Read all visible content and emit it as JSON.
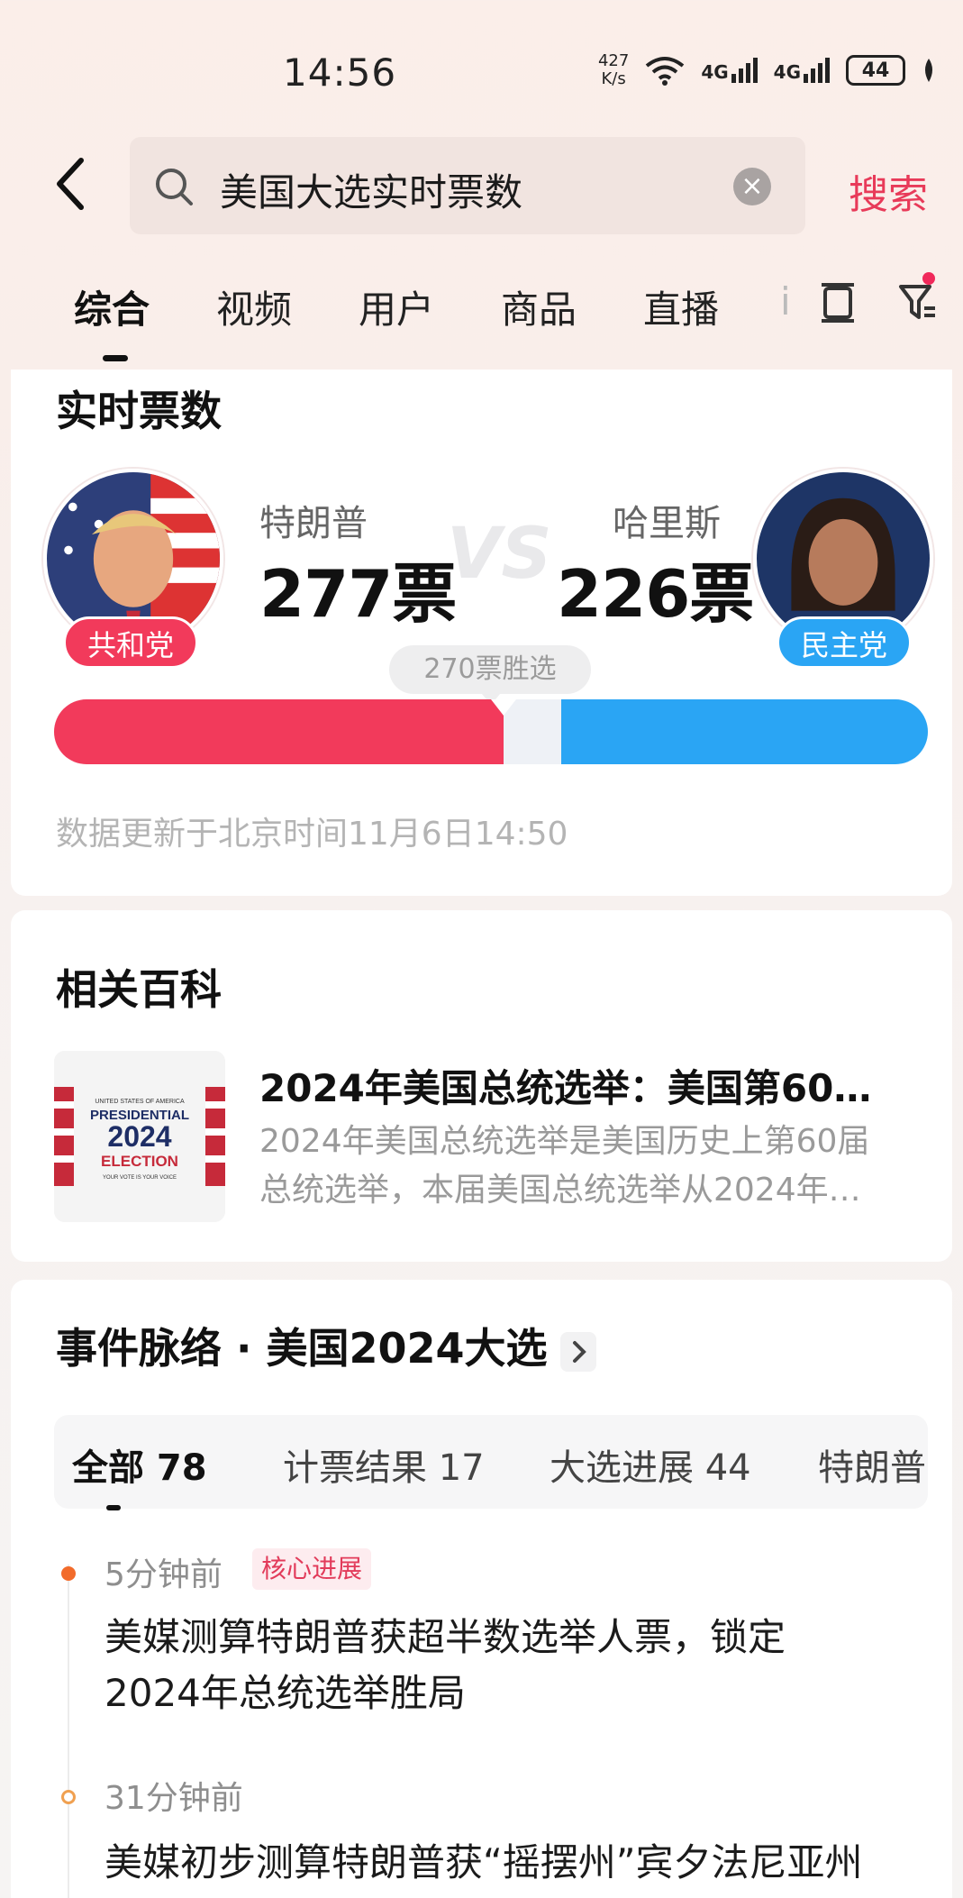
{
  "status_bar": {
    "time": "14:56",
    "net_speed_value": "427",
    "net_speed_unit": "K/s",
    "signal1_label": "4G",
    "signal2_label": "4G",
    "battery": "44"
  },
  "search": {
    "query": "美国大选实时票数",
    "search_button": "搜索"
  },
  "tabs": [
    {
      "label": "综合",
      "active": true
    },
    {
      "label": "视频"
    },
    {
      "label": "用户"
    },
    {
      "label": "商品"
    },
    {
      "label": "直播"
    },
    {
      "label": "i"
    }
  ],
  "realtime": {
    "title": "实时票数",
    "left": {
      "name": "特朗普",
      "votes": "277票",
      "party": "共和党",
      "color": "#f23a5b"
    },
    "right": {
      "name": "哈里斯",
      "votes": "226票",
      "party": "民主党",
      "color": "#2aa5f4"
    },
    "vs": "VS",
    "threshold_label": "270票胜选",
    "left_votes_num": 277,
    "right_votes_num": 226,
    "total_votes": 538,
    "updated": "数据更新于北京时间11月6日14:50"
  },
  "wiki": {
    "title": "相关百科",
    "item_title": "2024年美国总统选举：美国第60…",
    "item_desc_line1": "2024年美国总统选举是美国历史上第60届",
    "item_desc_line2": "总统选举，本届美国总统选举从2024年…",
    "thumb_top": "UNITED STATES OF AMERICA",
    "thumb_line1": "PRESIDENTIAL",
    "thumb_year": "2024",
    "thumb_line2": "ELECTION",
    "thumb_bottom": "YOUR VOTE IS YOUR VOICE"
  },
  "timeline": {
    "title": "事件脉络 · 美国2024大选",
    "subtabs": [
      {
        "label": "全部 78",
        "active": true
      },
      {
        "label": "计票结果 17"
      },
      {
        "label": "大选进展 44"
      },
      {
        "label": "特朗普"
      }
    ],
    "events": [
      {
        "time": "5分钟前",
        "tag": "核心进展",
        "line1": "美媒测算特朗普获超半数选举人票，锁定",
        "line2": "2024年总统选举胜局"
      },
      {
        "time": "31分钟前",
        "line1": "美媒初步测算特朗普获“摇摆州”宾夕法尼亚州"
      }
    ]
  }
}
